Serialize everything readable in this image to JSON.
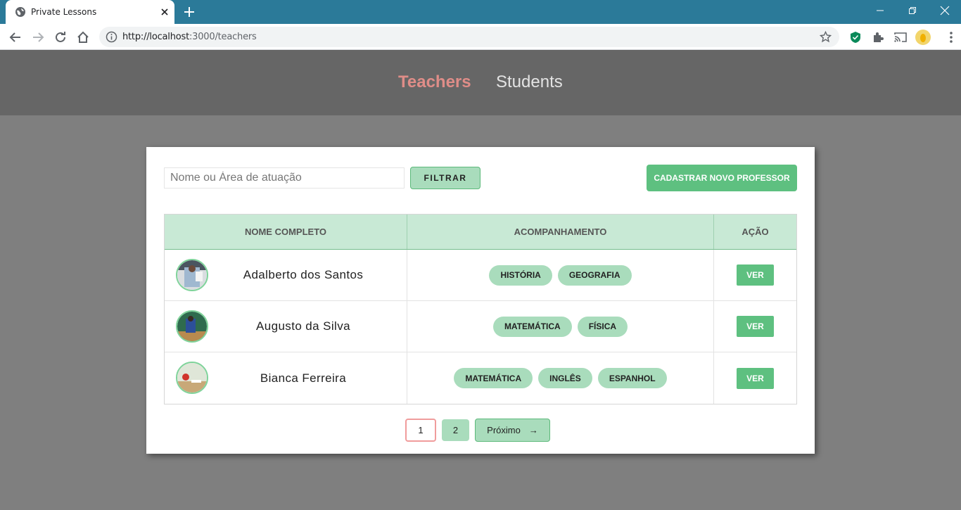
{
  "browser": {
    "tab_title": "Private Lessons",
    "url_host": "http://localhost",
    "url_path": ":3000/teachers",
    "icons": [
      "globe-icon",
      "close-icon",
      "plus-icon",
      "minimize-icon",
      "maximize-icon",
      "close-window-icon",
      "back-icon",
      "forward-icon",
      "reload-icon",
      "home-icon",
      "info-icon",
      "star-icon",
      "shield-icon",
      "puzzle-icon",
      "cast-icon",
      "profile-icon",
      "kebab-icon"
    ]
  },
  "header": {
    "nav": {
      "teachers": "Teachers",
      "students": "Students"
    },
    "active_color": "#df8d88"
  },
  "filter": {
    "placeholder": "Nome ou Área de atuação",
    "filter_label": "FILTRAR",
    "new_label": "CADASTRAR NOVO PROFESSOR"
  },
  "table": {
    "headers": [
      "NOME COMPLETO",
      "ACOMPANHAMENTO",
      "AÇÃO"
    ],
    "rows": [
      {
        "name": "Adalberto dos Santos",
        "subjects": [
          "HISTÓRIA",
          "GEOGRAFIA"
        ],
        "action": "VER"
      },
      {
        "name": "Augusto da Silva",
        "subjects": [
          "MATEMÁTICA",
          "FÍSICA"
        ],
        "action": "VER"
      },
      {
        "name": "Bianca Ferreira",
        "subjects": [
          "MATEMÁTICA",
          "INGLÊS",
          "ESPANHOL"
        ],
        "action": "VER"
      }
    ]
  },
  "pagination": {
    "pages": [
      "1",
      "2"
    ],
    "current": "1",
    "next_label": "Próximo",
    "next_arrow": "→"
  },
  "colors": {
    "accent": "#5ec080",
    "pill": "#a9dcbc",
    "table_head": "#c8e9d5"
  }
}
